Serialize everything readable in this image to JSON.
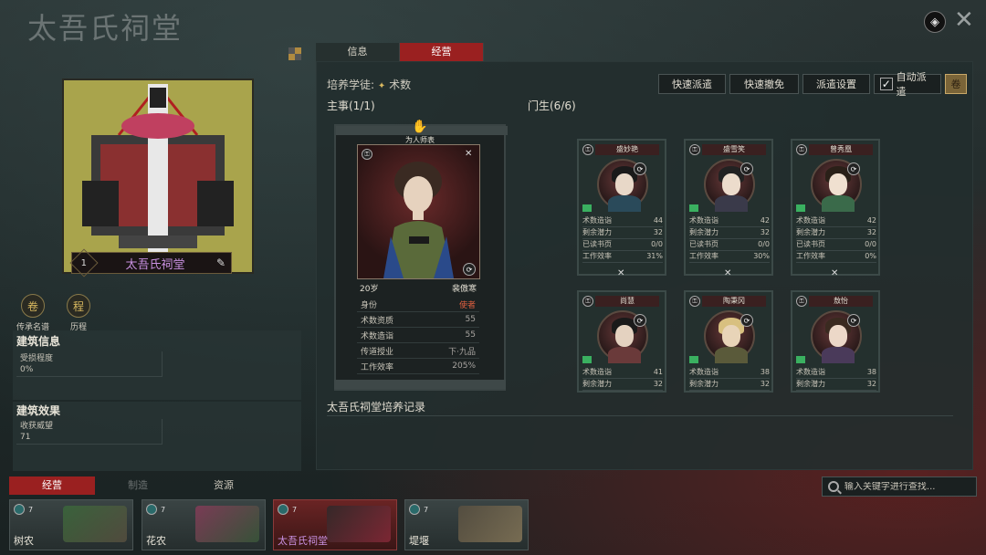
{
  "header": {
    "title": "太吾氏祠堂",
    "map_icon": "◈",
    "close_icon": "✕"
  },
  "building": {
    "level": "1",
    "name": "太吾氏祠堂",
    "edit_icon": "✎"
  },
  "functions": [
    {
      "label": "传承名谱",
      "icon": "卷"
    },
    {
      "label": "历程",
      "icon": "程"
    }
  ],
  "building_info": {
    "title": "建筑信息",
    "damage_label": "受损程度",
    "damage_value": "0%"
  },
  "building_effect": {
    "title": "建筑效果",
    "harvest_label": "收获威望",
    "harvest_value": "71"
  },
  "tabs": [
    {
      "label": "信息"
    },
    {
      "label": "经营"
    }
  ],
  "main": {
    "trainee_label": "培养学徒:",
    "trainee_skill": "术数",
    "buttons": {
      "quick_dispatch": "快速派遣",
      "quick_recall": "快速撤免",
      "dispatch_settings": "派遣设置",
      "auto_dispatch": "自动派遣"
    },
    "master_section": "主事(1/1)",
    "disciple_section": "门生(6/6)",
    "record_title": "太吾氏祠堂培养记录"
  },
  "master": {
    "title": "为人师表",
    "age": "20岁",
    "name": "裴傲寒",
    "rows": [
      {
        "label": "身份",
        "value": "使者"
      },
      {
        "label": "术数资质",
        "value": "55"
      },
      {
        "label": "术数造诣",
        "value": "55"
      },
      {
        "label": "传道授业",
        "value": "下·九品"
      },
      {
        "label": "工作效率",
        "value": "205%"
      }
    ]
  },
  "disciples": [
    {
      "name": "盛妙艳",
      "stats": [
        [
          "术数造诣",
          "44"
        ],
        [
          "剩余潜力",
          "32"
        ],
        [
          "已读书页",
          "0/0"
        ],
        [
          "工作效率",
          "31%"
        ]
      ]
    },
    {
      "name": "盛雪笑",
      "stats": [
        [
          "术数造诣",
          "42"
        ],
        [
          "剩余潜力",
          "32"
        ],
        [
          "已读书页",
          "0/0"
        ],
        [
          "工作效率",
          "30%"
        ]
      ]
    },
    {
      "name": "曾秀凰",
      "stats": [
        [
          "术数造诣",
          "42"
        ],
        [
          "剩余潜力",
          "32"
        ],
        [
          "已读书页",
          "0/0"
        ],
        [
          "工作效率",
          "0%"
        ]
      ]
    },
    {
      "name": "尚慧",
      "stats": [
        [
          "术数造诣",
          "41"
        ],
        [
          "剩余潜力",
          "32"
        ]
      ]
    },
    {
      "name": "陶秉冈",
      "stats": [
        [
          "术数造诣",
          "38"
        ],
        [
          "剩余潜力",
          "32"
        ]
      ]
    },
    {
      "name": "敖怡",
      "stats": [
        [
          "术数造诣",
          "38"
        ],
        [
          "剩余潜力",
          "32"
        ]
      ]
    }
  ],
  "bottom": {
    "tabs": [
      {
        "label": "经营"
      },
      {
        "label": "制造"
      },
      {
        "label": "资源"
      }
    ],
    "search_placeholder": "输入关键字进行查找...",
    "buildings": [
      {
        "name": "树农",
        "count": "7"
      },
      {
        "name": "花农",
        "count": "7"
      },
      {
        "name": "太吾氏祠堂",
        "count": "7"
      },
      {
        "name": "堤堰",
        "count": "7"
      }
    ]
  }
}
